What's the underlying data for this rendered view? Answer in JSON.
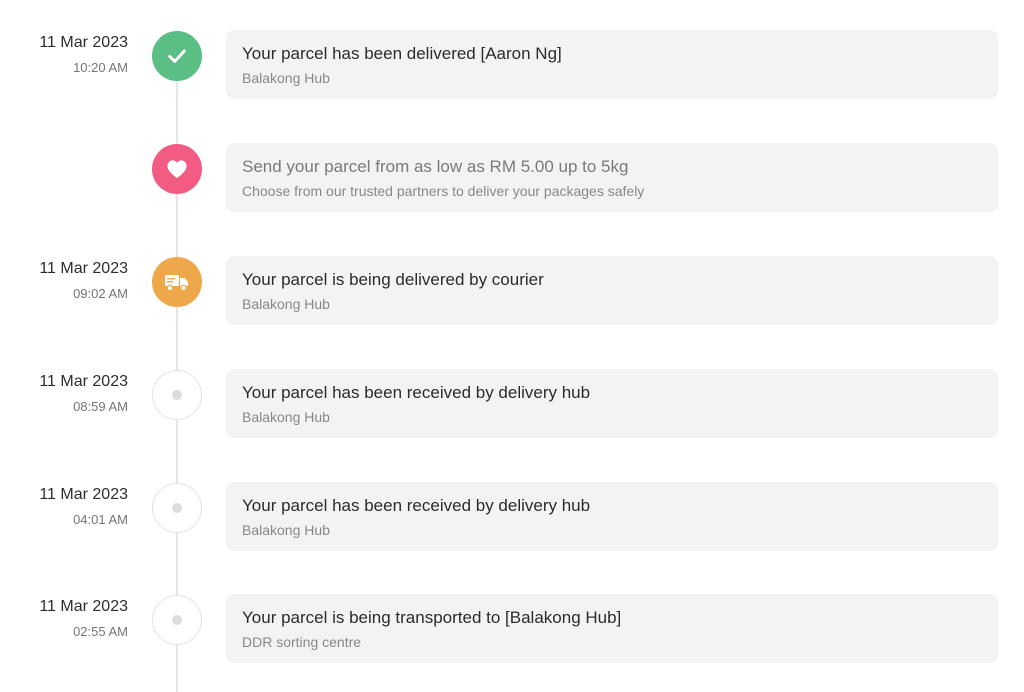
{
  "colors": {
    "delivered": "#5bbe84",
    "promo": "#f25c82",
    "courier": "#eea84a",
    "pending_border": "#e3e3e3",
    "card_bg": "#f3f3f3"
  },
  "events": [
    {
      "date": "11 Mar 2023",
      "time": "10:20 AM",
      "icon": "check-icon",
      "title": "Your parcel has been delivered [Aaron Ng]",
      "subtitle": "Balakong Hub"
    },
    {
      "date": "",
      "time": "",
      "icon": "heart-icon",
      "title": "Send your parcel from as low as RM 5.00 up to 5kg",
      "subtitle": "Choose from our trusted partners to deliver your packages safely"
    },
    {
      "date": "11 Mar 2023",
      "time": "09:02 AM",
      "icon": "truck-icon",
      "title": "Your parcel is being delivered by courier",
      "subtitle": "Balakong Hub"
    },
    {
      "date": "11 Mar 2023",
      "time": "08:59 AM",
      "icon": "dot-icon",
      "title": "Your parcel has been received by delivery hub",
      "subtitle": "Balakong Hub"
    },
    {
      "date": "11 Mar 2023",
      "time": "04:01 AM",
      "icon": "dot-icon",
      "title": "Your parcel has been received by delivery hub",
      "subtitle": "Balakong Hub"
    },
    {
      "date": "11 Mar 2023",
      "time": "02:55 AM",
      "icon": "dot-icon",
      "title": "Your parcel is being transported to [Balakong Hub]",
      "subtitle": "DDR sorting centre"
    }
  ]
}
